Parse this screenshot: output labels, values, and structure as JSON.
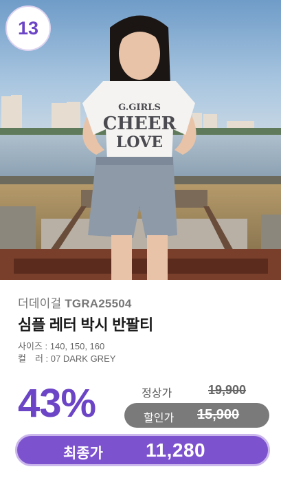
{
  "badge": {
    "rank": "13"
  },
  "photo": {
    "shirt_print": [
      "G.GIRLS",
      "CHEER",
      "LOVE"
    ]
  },
  "product": {
    "brand": "더데이걸",
    "code": "TGRA25504",
    "title": "심플 레터 박시 반팔티",
    "size_label": "사이즈",
    "size_value": "140, 150, 160",
    "color_label": "컬　러",
    "color_value": "07 DARK GREY"
  },
  "price": {
    "discount": "43%",
    "regular_label": "정상가",
    "regular_value": "19,900",
    "sale_label": "할인가",
    "sale_value": "15,900",
    "final_label": "최종가",
    "final_value": "11,280"
  },
  "colors": {
    "accent": "#7d52cf",
    "discount_text": "#6c45c6",
    "sale_pill": "#7a7a7a"
  }
}
